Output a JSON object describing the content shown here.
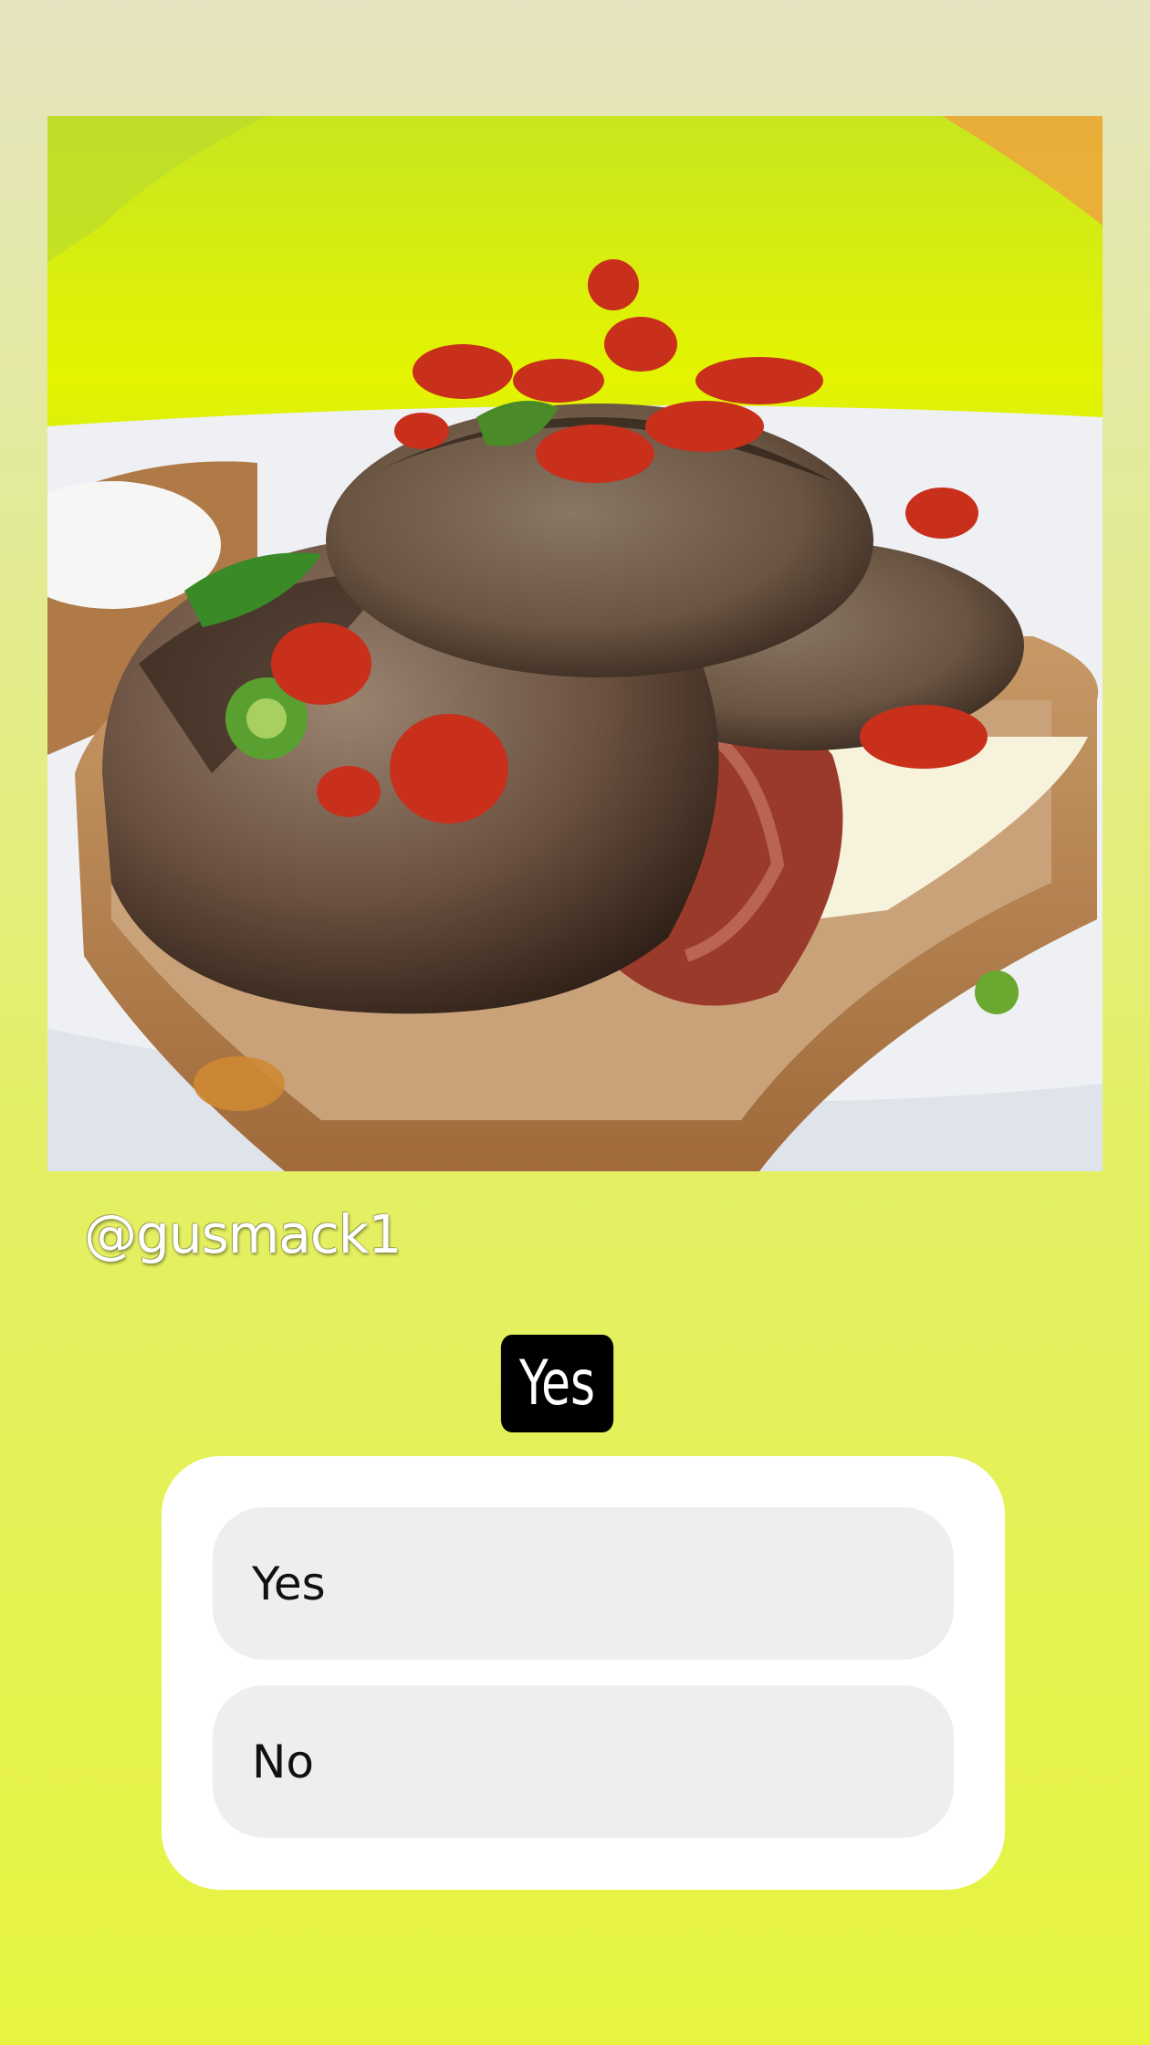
{
  "story": {
    "username": "@gusmack1",
    "question_sticker": "Yes",
    "poll_options": [
      {
        "label": "Yes"
      },
      {
        "label": "No"
      }
    ]
  },
  "colors": {
    "background_top": "#e6e4c0",
    "background_bottom": "#e6f440",
    "sticker_background": "#000000",
    "poll_card": "#ffffff",
    "poll_option": "#eeeeee"
  }
}
